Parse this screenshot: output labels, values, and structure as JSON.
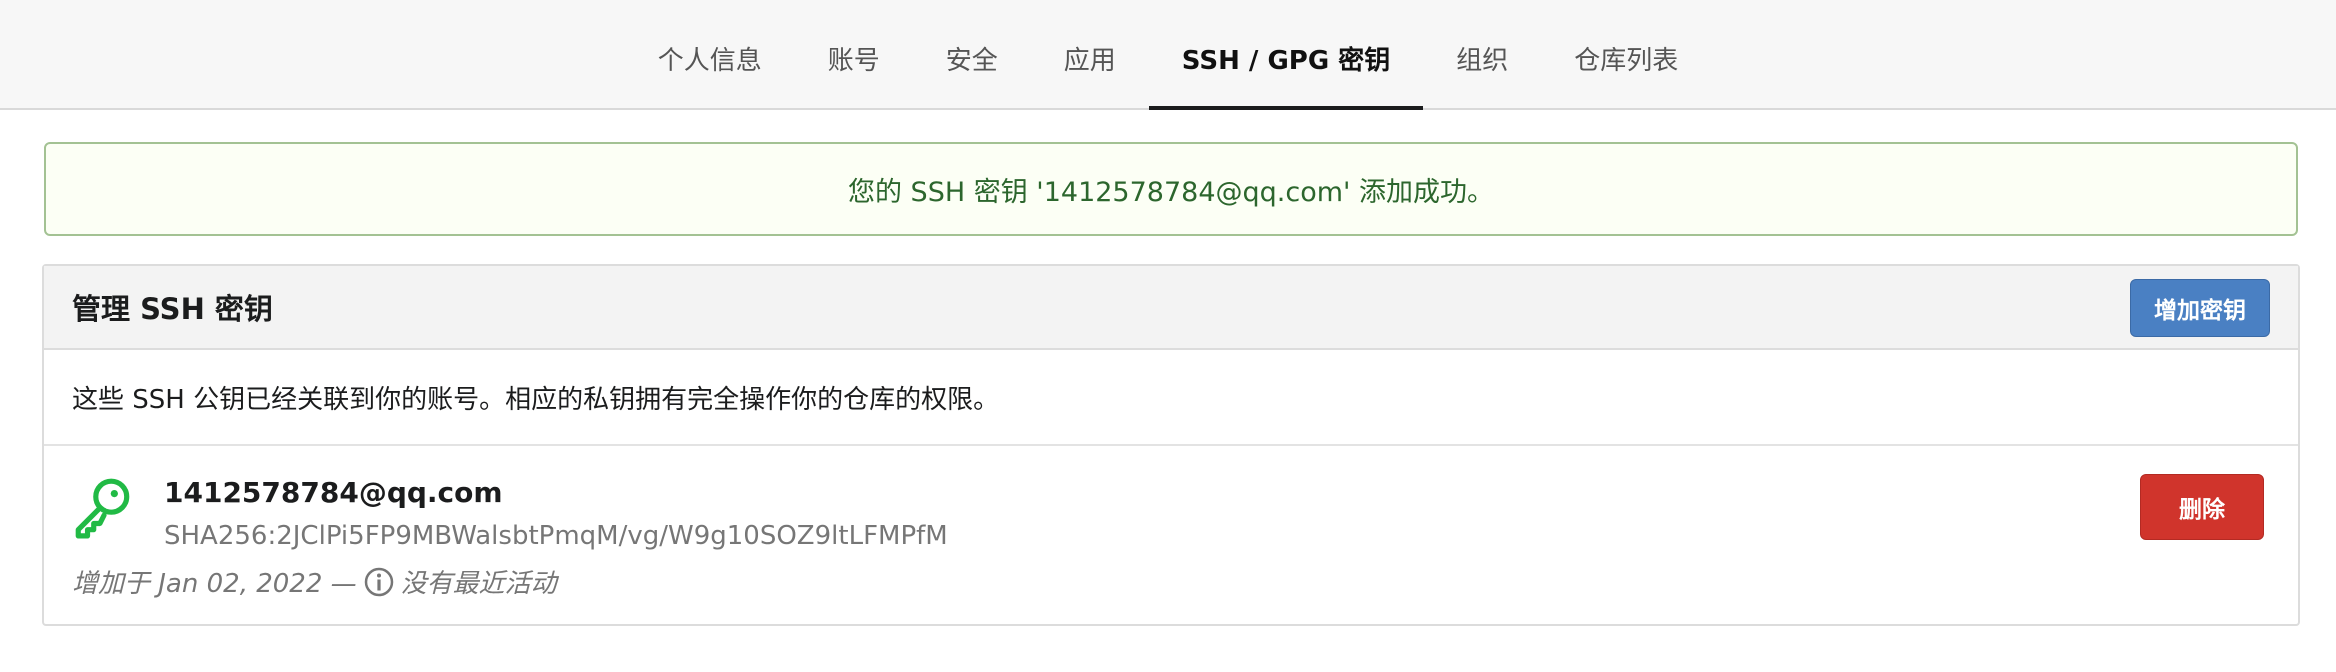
{
  "nav": {
    "tabs": [
      {
        "label": "个人信息",
        "active": false
      },
      {
        "label": "账号",
        "active": false
      },
      {
        "label": "安全",
        "active": false
      },
      {
        "label": "应用",
        "active": false
      },
      {
        "label": "SSH / GPG 密钥",
        "active": true
      },
      {
        "label": "组织",
        "active": false
      },
      {
        "label": "仓库列表",
        "active": false
      }
    ]
  },
  "alert": {
    "message": "您的 SSH 密钥 '1412578784@qq.com' 添加成功。",
    "color": "#2c662d"
  },
  "ssh_panel": {
    "title": "管理 SSH 密钥",
    "add_button": "增加密钥",
    "description": "这些 SSH 公钥已经关联到你的账号。相应的私钥拥有完全操作你的仓库的权限。",
    "keys": [
      {
        "name": "1412578784@qq.com",
        "fingerprint": "SHA256:2JClPi5FP9MBWalsbtPmqM/vg/W9g10SOZ9ltLFMPfM",
        "added_prefix": "增加于 Jan 02, 2022 —",
        "activity": "没有最近活动",
        "icon": "key-icon",
        "icon_color": "#21ba45",
        "delete_button": "删除"
      }
    ]
  },
  "colors": {
    "add_button": "#4a80c3",
    "delete_button": "#d0342c"
  }
}
